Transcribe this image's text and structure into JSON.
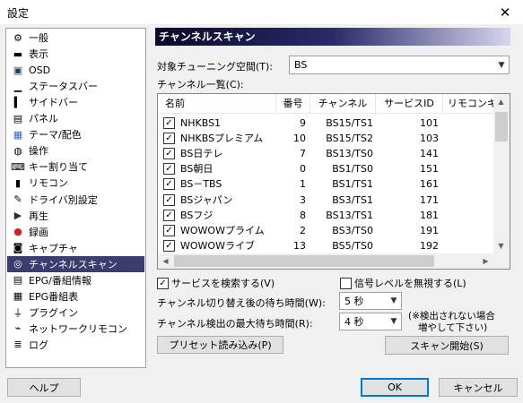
{
  "window": {
    "title": "設定",
    "close_glyph": "✕"
  },
  "sidebar": {
    "items": [
      {
        "label": "一般",
        "icon": "gear-icon"
      },
      {
        "label": "表示",
        "icon": "display-icon"
      },
      {
        "label": "OSD",
        "icon": "osd-icon"
      },
      {
        "label": "ステータスバー",
        "icon": "statusbar-icon"
      },
      {
        "label": "サイドバー",
        "icon": "sidebar-icon"
      },
      {
        "label": "パネル",
        "icon": "panel-icon"
      },
      {
        "label": "テーマ/配色",
        "icon": "palette-icon"
      },
      {
        "label": "操作",
        "icon": "mouse-icon"
      },
      {
        "label": "キー割り当て",
        "icon": "keyboard-icon"
      },
      {
        "label": "リモコン",
        "icon": "remote-icon"
      },
      {
        "label": "ドライバ別設定",
        "icon": "driver-icon"
      },
      {
        "label": "再生",
        "icon": "play-icon"
      },
      {
        "label": "録画",
        "icon": "record-icon"
      },
      {
        "label": "キャプチャ",
        "icon": "camera-icon"
      },
      {
        "label": "チャンネルスキャン",
        "icon": "scan-icon"
      },
      {
        "label": "EPG/番組情報",
        "icon": "epg-icon"
      },
      {
        "label": "EPG番組表",
        "icon": "program-guide-icon"
      },
      {
        "label": "プラグイン",
        "icon": "plugin-icon"
      },
      {
        "label": "ネットワークリモコン",
        "icon": "network-remote-icon"
      },
      {
        "label": "ログ",
        "icon": "log-icon"
      }
    ],
    "selected_index": 14
  },
  "panel": {
    "title": "チャンネルスキャン",
    "tuning_space_label": "対象チューニング空間(T):",
    "tuning_space_value": "BS",
    "channel_list_label": "チャンネル一覧(C):",
    "columns": [
      "名前",
      "番号",
      "チャンネル",
      "サービスID",
      "リモコンキ"
    ],
    "rows": [
      {
        "name": "NHKBS1",
        "number": "9",
        "channel": "BS15/TS1",
        "service_id": "101",
        "checked": true
      },
      {
        "name": "NHKBSプレミアム",
        "number": "10",
        "channel": "BS15/TS2",
        "service_id": "103",
        "checked": true
      },
      {
        "name": "BS日テレ",
        "number": "7",
        "channel": "BS13/TS0",
        "service_id": "141",
        "checked": true
      },
      {
        "name": "BS朝日",
        "number": "0",
        "channel": "BS1/TS0",
        "service_id": "151",
        "checked": true
      },
      {
        "name": "BS－TBS",
        "number": "1",
        "channel": "BS1/TS1",
        "service_id": "161",
        "checked": true
      },
      {
        "name": "BSジャパン",
        "number": "3",
        "channel": "BS3/TS1",
        "service_id": "171",
        "checked": true
      },
      {
        "name": "BSフジ",
        "number": "8",
        "channel": "BS13/TS1",
        "service_id": "181",
        "checked": true
      },
      {
        "name": "WOWOWプライム",
        "number": "2",
        "channel": "BS3/TS0",
        "service_id": "191",
        "checked": true
      },
      {
        "name": "WOWOWライブ",
        "number": "13",
        "channel": "BS5/TS0",
        "service_id": "192",
        "checked": true
      },
      {
        "name": "WOWOWシネマ",
        "number": "14",
        "channel": "BS5/TS1",
        "service_id": "193",
        "checked": true
      }
    ],
    "search_services_label": "サービスを検索する(V)",
    "search_services_checked": true,
    "ignore_signal_label": "信号レベルを無視する(L)",
    "ignore_signal_checked": false,
    "switch_wait_label": "チャンネル切り替え後の待ち時間(W):",
    "switch_wait_value": "5 秒",
    "detect_wait_label": "チャンネル検出の最大待ち時間(R):",
    "detect_wait_value": "4 秒",
    "note_line1": "(※検出されない場合",
    "note_line2": "増やして下さい)",
    "preset_button": "プリセット読み込み(P)",
    "scan_button": "スキャン開始(S)"
  },
  "footer": {
    "help": "ヘルプ",
    "ok": "OK",
    "cancel": "キャンセル"
  },
  "colors": {
    "selected_bg": "#3c3c6e",
    "header_gradient_start": "#0a0a2a",
    "button_focus": "#0078d7"
  }
}
